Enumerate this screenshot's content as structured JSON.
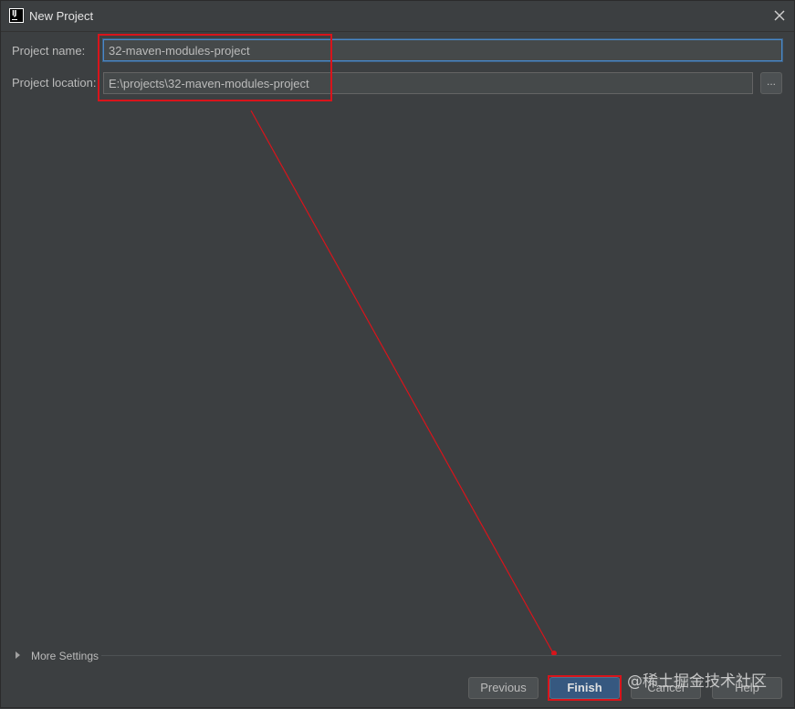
{
  "window": {
    "title": "New Project",
    "app_icon": "intellij-idea-icon",
    "app_icon_text": "IJ"
  },
  "form": {
    "project_name_label": "Project name:",
    "project_name_value": "32-maven-modules-project",
    "project_location_label": "Project location:",
    "project_location_value": "E:\\projects\\32-maven-modules-project",
    "browse_label": "..."
  },
  "more_settings": {
    "label": "More Settings",
    "expanded": false
  },
  "buttons": {
    "previous_label": "Previous",
    "finish_label": "Finish",
    "cancel_label": "Cancel",
    "help_label": "Help"
  },
  "watermark": {
    "text": "@稀土掘金技术社区"
  },
  "colors": {
    "background": "#3c3f41",
    "field_background": "#45494a",
    "focus_border": "#4a88c7",
    "primary_button": "#365880",
    "annotation_red": "#d9141b"
  },
  "icons": {
    "close": "close-icon",
    "expand": "triangle-right-icon"
  }
}
